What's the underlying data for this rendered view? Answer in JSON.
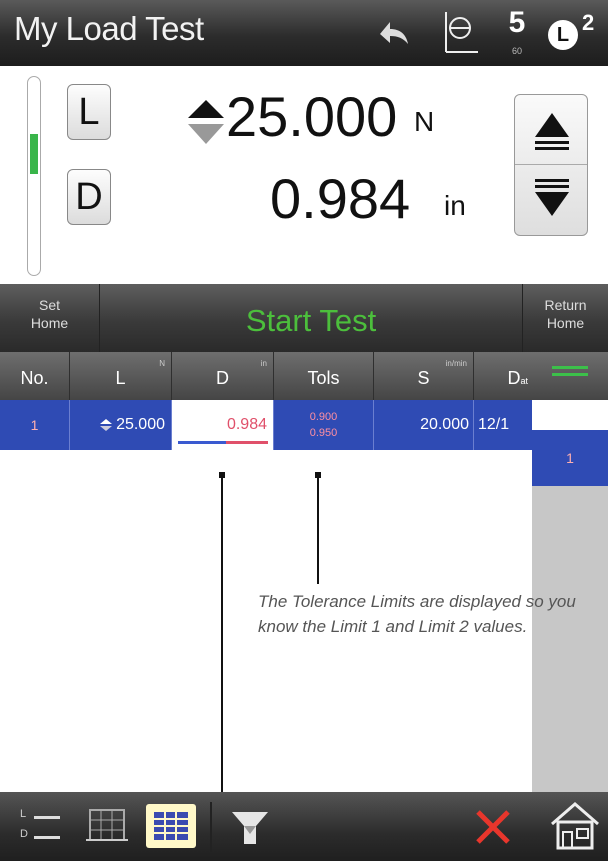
{
  "titlebar": {
    "title": "My Load Test",
    "icons": [
      "undo-icon",
      "chart-reference-icon",
      "units-icon",
      "limits-l2-icon"
    ],
    "units_icon": {
      "big": "5",
      "small": "60"
    },
    "limits_icon": {
      "letter": "L",
      "sup": "2"
    }
  },
  "readout": {
    "load_button": "L",
    "disp_button": "D",
    "load_value": "25.000",
    "load_unit": "N",
    "disp_value": "0.984",
    "disp_unit": "in",
    "level_fraction": 0.37,
    "accent_green": "#39b54a"
  },
  "commands": {
    "set_home": [
      "Set",
      "Home"
    ],
    "start_test": "Start Test",
    "return_home": [
      "Return",
      "Home"
    ],
    "start_color": "#4cbf3c"
  },
  "table": {
    "headers": {
      "no": "No.",
      "l": "L",
      "l_unit": "N",
      "d": "D",
      "d_unit": "in",
      "tols": "Tols",
      "s": "S",
      "s_unit": "in/min",
      "date": "D",
      "date_sub": "at"
    },
    "rows": [
      {
        "no": "1",
        "l": "25.000",
        "d": "0.984",
        "tol_low": "0.900",
        "tol_high": "0.950",
        "s": "20.000",
        "date": "12/1"
      }
    ],
    "row_color": "#2f4bb4"
  },
  "sidebar": {
    "page_label": "1"
  },
  "callout": {
    "text": "The Tolerance Limits are displayed so you know the Limit 1 and Limit 2 values."
  },
  "toolbar": {
    "ld_labels": [
      "L",
      "D"
    ],
    "delete_color": "#e8362c"
  }
}
